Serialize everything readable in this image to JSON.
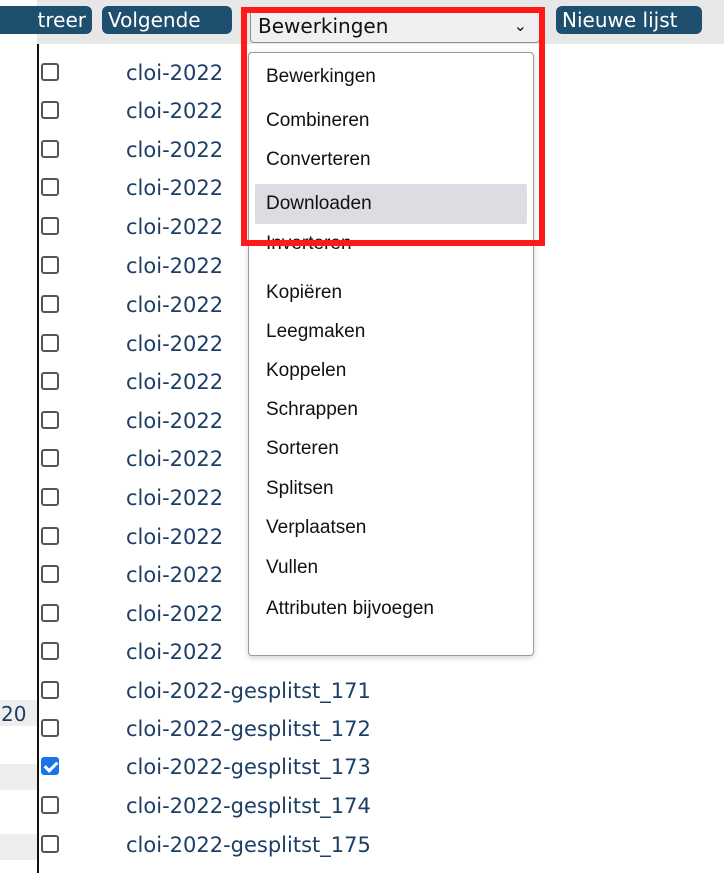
{
  "background": {
    "fragment_text": "20"
  },
  "toolbar": {
    "buttons": [
      {
        "label": "treer"
      },
      {
        "label": "Volgende"
      },
      {
        "label": "Nieuwe lijst"
      }
    ],
    "select": {
      "value": "Bewerkingen",
      "chevron": "⌄"
    }
  },
  "dropdown": {
    "options": [
      {
        "label": "Bewerkingen"
      },
      {
        "label": "Combineren"
      },
      {
        "label": "Converteren"
      },
      {
        "label": "Downloaden",
        "highlighted": true
      },
      {
        "label": "Inverteren"
      },
      {
        "label": "Kopiëren"
      },
      {
        "label": "Leegmaken"
      },
      {
        "label": "Koppelen"
      },
      {
        "label": "Schrappen"
      },
      {
        "label": "Sorteren"
      },
      {
        "label": "Splitsen"
      },
      {
        "label": "Verplaatsen"
      },
      {
        "label": "Vullen"
      },
      {
        "label": "Attributen bijvoegen"
      }
    ]
  },
  "list": {
    "items": [
      {
        "name": "cloi-2022",
        "checked": false
      },
      {
        "name": "cloi-2022",
        "checked": false
      },
      {
        "name": "cloi-2022",
        "checked": false
      },
      {
        "name": "cloi-2022",
        "checked": false
      },
      {
        "name": "cloi-2022",
        "checked": false
      },
      {
        "name": "cloi-2022",
        "checked": false
      },
      {
        "name": "cloi-2022",
        "checked": false
      },
      {
        "name": "cloi-2022",
        "checked": false
      },
      {
        "name": "cloi-2022",
        "checked": false
      },
      {
        "name": "cloi-2022",
        "checked": false
      },
      {
        "name": "cloi-2022",
        "checked": false
      },
      {
        "name": "cloi-2022",
        "checked": false
      },
      {
        "name": "cloi-2022",
        "checked": false
      },
      {
        "name": "cloi-2022",
        "checked": false
      },
      {
        "name": "cloi-2022",
        "checked": false
      },
      {
        "name": "cloi-2022",
        "checked": false
      },
      {
        "name": "cloi-2022-gesplitst_171",
        "checked": false
      },
      {
        "name": "cloi-2022-gesplitst_172",
        "checked": false
      },
      {
        "name": "cloi-2022-gesplitst_173",
        "checked": true
      },
      {
        "name": "cloi-2022-gesplitst_174",
        "checked": false
      },
      {
        "name": "cloi-2022-gesplitst_175",
        "checked": false
      }
    ]
  },
  "colors": {
    "button_bg": "#1f4f6e",
    "link_text": "#1d3f66",
    "highlight_border": "#ff1a1a",
    "checkbox_checked": "#1a73e8"
  }
}
